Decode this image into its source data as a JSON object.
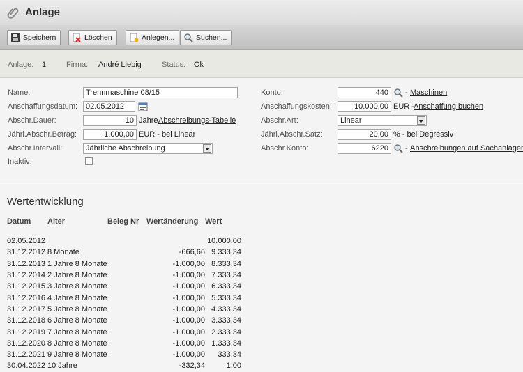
{
  "window": {
    "title": "Anlage",
    "icon": "paperclip-icon"
  },
  "toolbar": {
    "save": "Speichern",
    "delete": "Löschen",
    "create": "Anlegen...",
    "search": "Suchen..."
  },
  "info": {
    "anlage_label": "Anlage:",
    "anlage_value": "1",
    "firma_label": "Firma:",
    "firma_value": "André Liebig",
    "status_label": "Status:",
    "status_value": "Ok"
  },
  "form": {
    "name_label": "Name:",
    "name_value": "Trennmaschine 08/15",
    "date_label": "Anschaffungsdatum:",
    "date_value": "02.05.2012",
    "duration_label": "Abschr.Dauer:",
    "duration_value": "10",
    "duration_unit": "Jahre",
    "duration_link": "Abschreibungs-Tabelle",
    "annual_label": "Jährl.Abschr.Betrag:",
    "annual_value": "1.000,00",
    "annual_suffix": "EUR - bei Linear",
    "interval_label": "Abschr.Intervall:",
    "interval_value": "Jährliche Abschreibung",
    "inactive_label": "Inaktiv:",
    "konto_label": "Konto:",
    "konto_value": "440",
    "konto_link": "Maschinen",
    "cost_label": "Anschaffungskosten:",
    "cost_value": "10.000,00",
    "cost_suffix": "EUR -",
    "cost_link": "Anschaffung buchen",
    "type_label": "Abschr.Art:",
    "type_value": "Linear",
    "rate_label": "Jährl.Abschr.Satz:",
    "rate_value": "20,00",
    "rate_suffix": "% - bei Degressiv",
    "account_label": "Abschr.Konto:",
    "account_value": "6220",
    "account_link": "Abschreibungen auf Sachanlagen",
    "dash": "-"
  },
  "development": {
    "title": "Wertentwicklung",
    "headers": {
      "date": "Datum",
      "age": "Alter",
      "beleg": "Beleg Nr",
      "change": "Wertänderung",
      "value": "Wert"
    },
    "rows": [
      {
        "date": "02.05.2012",
        "age": "",
        "beleg": "",
        "change": "",
        "value": "10.000,00"
      },
      {
        "date": "31.12.2012",
        "age": "8 Monate",
        "beleg": "",
        "change": "-666,66",
        "value": "9.333,34"
      },
      {
        "date": "31.12.2013",
        "age": "1 Jahre 8 Monate",
        "beleg": "",
        "change": "-1.000,00",
        "value": "8.333,34"
      },
      {
        "date": "31.12.2014",
        "age": "2 Jahre 8 Monate",
        "beleg": "",
        "change": "-1.000,00",
        "value": "7.333,34"
      },
      {
        "date": "31.12.2015",
        "age": "3 Jahre 8 Monate",
        "beleg": "",
        "change": "-1.000,00",
        "value": "6.333,34"
      },
      {
        "date": "31.12.2016",
        "age": "4 Jahre 8 Monate",
        "beleg": "",
        "change": "-1.000,00",
        "value": "5.333,34"
      },
      {
        "date": "31.12.2017",
        "age": "5 Jahre 8 Monate",
        "beleg": "",
        "change": "-1.000,00",
        "value": "4.333,34"
      },
      {
        "date": "31.12.2018",
        "age": "6 Jahre 8 Monate",
        "beleg": "",
        "change": "-1.000,00",
        "value": "3.333,34"
      },
      {
        "date": "31.12.2019",
        "age": "7 Jahre 8 Monate",
        "beleg": "",
        "change": "-1.000,00",
        "value": "2.333,34"
      },
      {
        "date": "31.12.2020",
        "age": "8 Jahre 8 Monate",
        "beleg": "",
        "change": "-1.000,00",
        "value": "1.333,34"
      },
      {
        "date": "31.12.2021",
        "age": "9 Jahre 8 Monate",
        "beleg": "",
        "change": "-1.000,00",
        "value": "333,34"
      },
      {
        "date": "30.04.2022",
        "age": "10 Jahre",
        "beleg": "",
        "change": "-332,34",
        "value": "1,00"
      }
    ]
  }
}
